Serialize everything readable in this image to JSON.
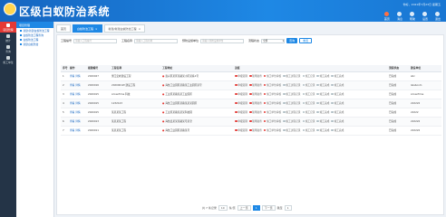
{
  "header": {
    "system_title": "区级白蚁防治系统",
    "user_info": "你好，2021年7月23日 星期五",
    "nav": [
      {
        "label": "首页",
        "icon": "home-icon",
        "active": true
      },
      {
        "label": "消息",
        "icon": "message-icon",
        "active": false
      },
      {
        "label": "帮助",
        "icon": "help-icon",
        "active": false
      },
      {
        "label": "设置",
        "icon": "gear-icon",
        "active": false
      },
      {
        "label": "退出",
        "icon": "logout-icon",
        "active": false
      }
    ]
  },
  "leftbar": {
    "items": [
      {
        "label": "项目管理",
        "icon": "project-icon",
        "active": true
      },
      {
        "label": "统计",
        "icon": "chart-icon",
        "active": false
      },
      {
        "label": "查询",
        "icon": "search-icon",
        "active": false
      },
      {
        "label": "施工单位",
        "icon": "building-icon",
        "active": false
      }
    ]
  },
  "submenu": {
    "title": "项目管理",
    "items": [
      "新建/新建白蚁防治工程",
      "白蚁防治工程查询",
      "白蚁防治工程",
      "新建白蚁防治"
    ]
  },
  "tabs": [
    {
      "label": "首页",
      "active": false
    },
    {
      "label": "白蚁防治工程",
      "active": true
    },
    {
      "label": "新建/新建白蚁防治工程",
      "active": false
    }
  ],
  "filters": {
    "project_no_label": "工程编号",
    "project_no_placeholder": "请输入工程编号",
    "project_name_label": "工程名称",
    "project_name_placeholder": "请输入工程名称",
    "company_label": "预防设施单位",
    "company_placeholder": "请输入预防设施单位",
    "status_label": "流程状态",
    "status_value": "全部",
    "search_label": "查询",
    "reset_label": "重置"
  },
  "table": {
    "headers": [
      "序号",
      "操作",
      "报建编号",
      "工程名称",
      "工程地址",
      "进度",
      "流程状态",
      "建设单位"
    ],
    "rows": [
      {
        "no": "1",
        "action": "查看 详情",
        "code": "2020027",
        "name": "浙江宏峰建设工程",
        "address": "嘉兴区某区某路某小区某栋1号",
        "status": "已完成",
        "company": "abc"
      },
      {
        "no": "2",
        "action": "查看 详情",
        "code": "2020016",
        "name": "2020001W 建设工程",
        "address": "海盐工业园区某路某工业园区某号",
        "status": "已完成",
        "company": "lalaboom"
      },
      {
        "no": "3",
        "action": "查看 详情",
        "code": "2020015",
        "name": "ArcaeTime 科技",
        "address": "工业区某路某某工业园区",
        "status": "已完成",
        "company": "ArcaeTime"
      },
      {
        "no": "4",
        "action": "查看 详情",
        "code": "2020015",
        "name": "1232123",
        "address": "海盐工业园区某路某某某园区",
        "status": "已完成",
        "company": "222222"
      },
      {
        "no": "5",
        "action": "查看 详情",
        "code": "2020015",
        "name": "某某某某工程",
        "address": "工业区某路某某某科技园",
        "status": "已完成",
        "company": "22222"
      },
      {
        "no": "6",
        "action": "查看 详情",
        "code": "2020013",
        "name": "某某某某工程",
        "address": "海盐县某某某路某号某室",
        "status": "已完成",
        "company": "222222"
      },
      {
        "no": "7",
        "action": "查看 详情",
        "code": "2020011",
        "name": "某某某某工程",
        "address": "海盐工业园区某路某号",
        "status": "已完成",
        "company": "222222"
      }
    ],
    "progress_steps": [
      "申报受理",
      "现场勘查",
      "施工单位审核",
      "施工过程记录",
      "施工记录",
      "竣工完成",
      "竣工完成"
    ]
  },
  "pager": {
    "total_text": "共 7 条记录",
    "per_page": "10",
    "per_page_unit": "条/页",
    "prev": "上一页",
    "next": "下一页",
    "current_page": "1",
    "goto_label": "跳至"
  }
}
